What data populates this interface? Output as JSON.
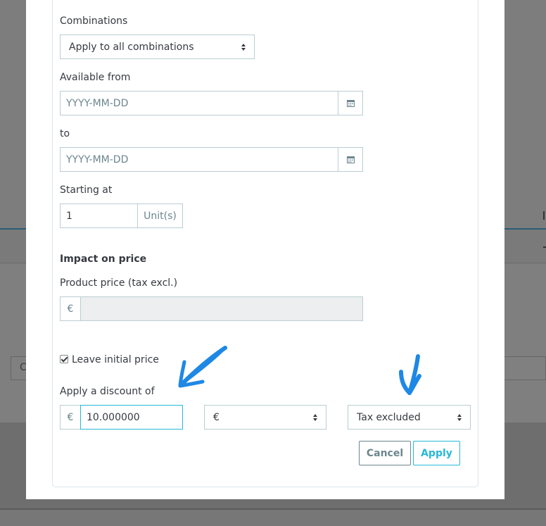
{
  "background": {
    "field_text": "C"
  },
  "form": {
    "combinations": {
      "label": "Combinations",
      "selected": "Apply to all combinations"
    },
    "available_from": {
      "label": "Available from",
      "placeholder": "YYYY-MM-DD"
    },
    "to": {
      "label": "to",
      "placeholder": "YYYY-MM-DD"
    },
    "starting_at": {
      "label": "Starting at",
      "value": "1",
      "unit": "Unit(s)"
    },
    "impact_heading": "Impact on price",
    "product_price": {
      "label": "Product price (tax excl.)",
      "currency": "€",
      "value": ""
    },
    "leave_initial_price": {
      "label": "Leave initial price",
      "checked": true
    },
    "discount": {
      "label": "Apply a discount of",
      "currency": "€",
      "value": "10.000000",
      "type_selected": "€",
      "tax_selected": "Tax excluded"
    },
    "buttons": {
      "cancel": "Cancel",
      "apply": "Apply"
    }
  },
  "icons": {
    "calendar": "calendar-icon",
    "annotation_color": "#1e88e5"
  }
}
